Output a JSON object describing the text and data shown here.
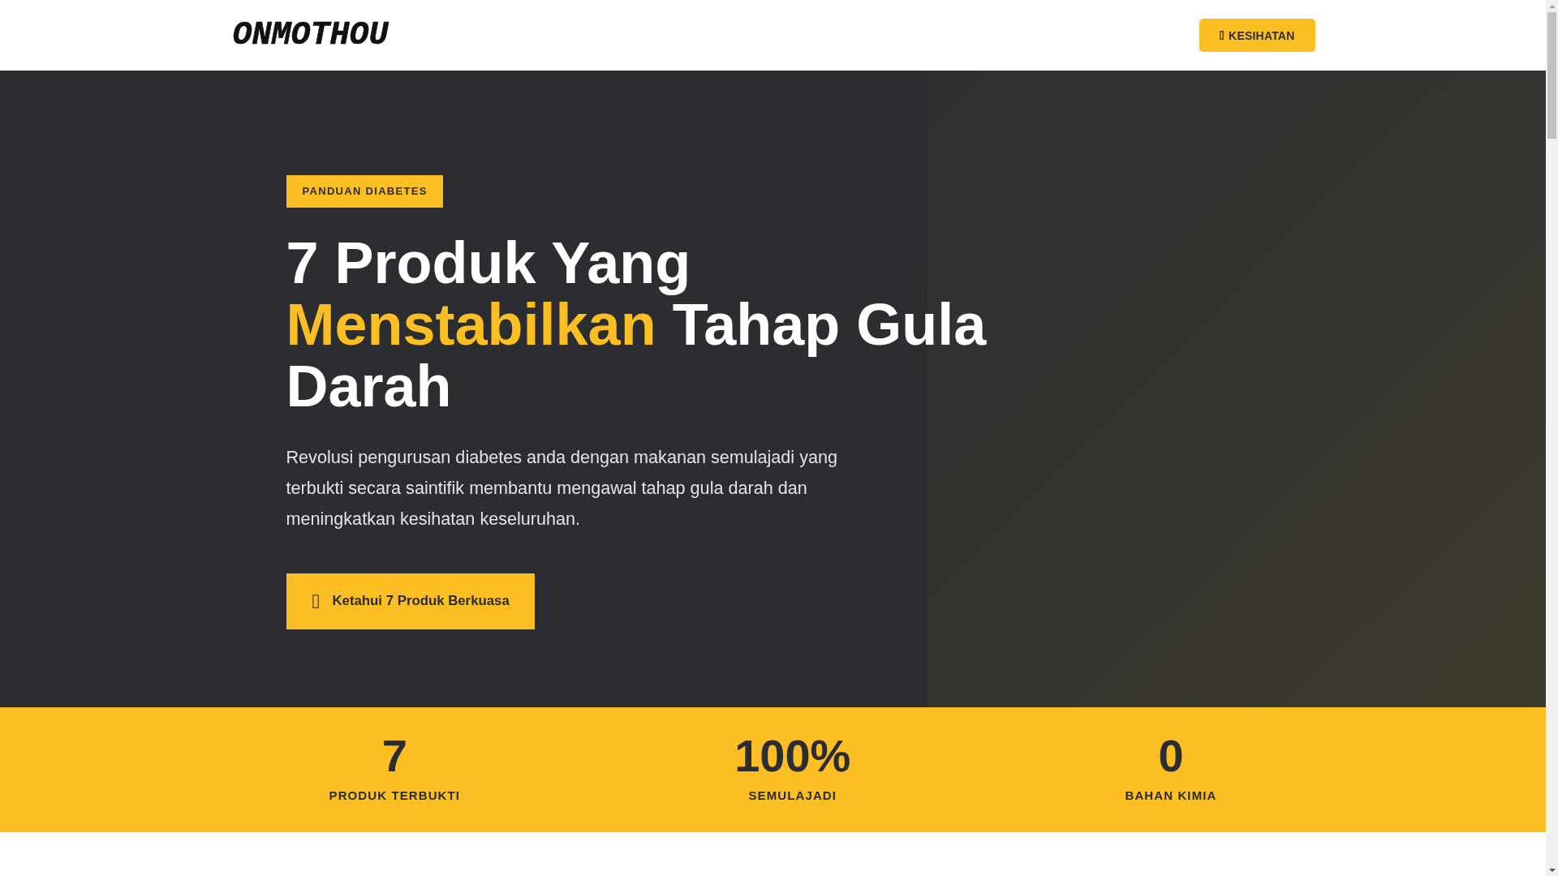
{
  "header": {
    "logo": "ONMOTHOU",
    "nav_button": {
      "label": "KESIHATAN"
    }
  },
  "hero": {
    "badge": "PANDUAN DIABETES",
    "title": [
      {
        "text": "7 Produk Yang",
        "highlighted": false
      },
      {
        "text": "Menstabilkan",
        "highlighted": true
      },
      {
        "text": "Tahap Gula Darah",
        "highlighted": false
      }
    ],
    "description": "Revolusi pengurusan diabetes anda dengan makanan semulajadi yang terbukti secara saintifik membantu mengawal tahap gula darah dan meningkatkan kesihatan keseluruhan.",
    "cta_button": {
      "label": "Ketahui 7 Produk Berkuasa"
    }
  },
  "stats": [
    {
      "value": "7",
      "label": "PRODUK TERBUKTI"
    },
    {
      "value": "100%",
      "label": "SEMULAJADI"
    },
    {
      "value": "0",
      "label": "BAHAN KIMIA"
    }
  ]
}
